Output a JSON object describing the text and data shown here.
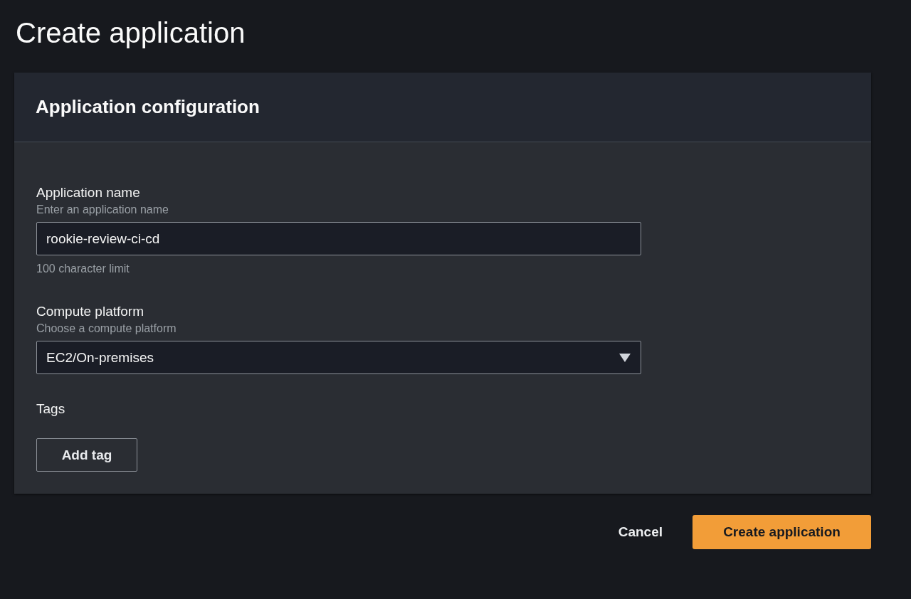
{
  "page_title": "Create application",
  "panel": {
    "title": "Application configuration",
    "fields": [
      {
        "kind": "input",
        "label": "Application name",
        "description": "Enter an application name",
        "value": "rookie-review-ci-cd",
        "constraint": "100 character limit"
      },
      {
        "kind": "select",
        "label": "Compute platform",
        "description": "Choose a compute platform",
        "value": "EC2/On-premises"
      }
    ],
    "tags": {
      "label": "Tags",
      "button": "Add tag"
    }
  },
  "actions": [
    {
      "kind": "link",
      "label": "Cancel"
    },
    {
      "kind": "primary",
      "label": "Create application"
    }
  ]
}
